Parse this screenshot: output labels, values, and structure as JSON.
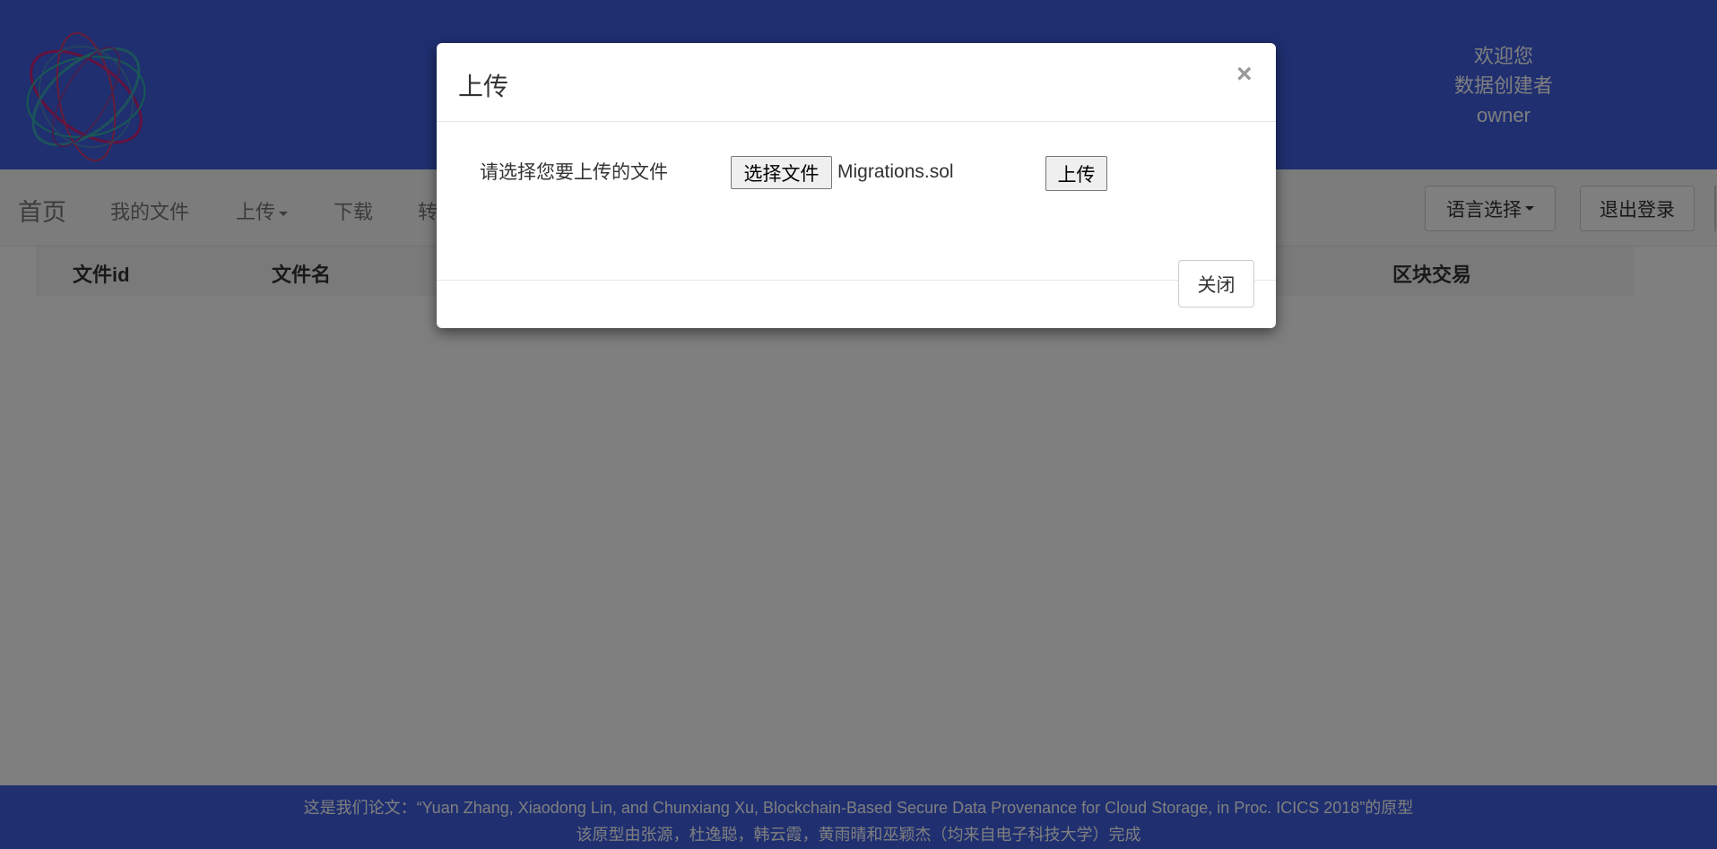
{
  "header": {
    "welcome_line1": "欢迎您",
    "welcome_line2": "数据创建者",
    "username": "owner"
  },
  "nav": {
    "brand": "首页",
    "items": [
      {
        "label": "我的文件"
      },
      {
        "label": "上传"
      },
      {
        "label": "下载"
      },
      {
        "label": "转"
      }
    ],
    "language_label": "语言选择",
    "logout_label": "退出登录"
  },
  "table": {
    "columns": [
      "文件id",
      "文件名",
      "区块交易"
    ]
  },
  "modal": {
    "title": "上传",
    "close_symbol": "×",
    "prompt": "请选择您要上传的文件",
    "choose_file_label": "选择文件",
    "file_name": "Migrations.sol",
    "upload_label": "上传",
    "close_label": "关闭"
  },
  "footer": {
    "line1": "这是我们论文：“Yuan Zhang, Xiaodong Lin, and Chunxiang Xu, Blockchain-Based Secure Data Provenance for Cloud Storage, in Proc. ICICS 2018”的原型",
    "line2": "该原型由张源，杜逸聪，韩云霞，黄雨晴和巫颖杰（均来自电子科技大学）完成"
  },
  "colors": {
    "header_blue": "#3f5fe0",
    "backdrop": "rgba(0,0,0,0.5)"
  }
}
